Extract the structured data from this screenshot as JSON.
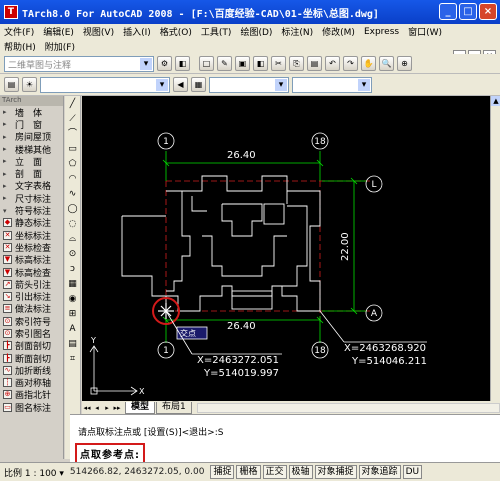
{
  "title": "TArch8.0 For AutoCAD 2008 - [F:\\百度经验-CAD\\01-坐标\\总图.dwg]",
  "window_buttons": {
    "minimize": "_",
    "maximize": "□",
    "close": "×"
  },
  "menu": {
    "row1": [
      "文件(F)",
      "编辑(E)",
      "视图(V)",
      "插入(I)",
      "格式(O)",
      "工具(T)",
      "绘图(D)",
      "标注(N)",
      "修改(M)",
      "Express",
      "窗口(W)"
    ],
    "row2": [
      "帮助(H)",
      "附加(F)"
    ]
  },
  "toolbar": {
    "workspace": "二维草图与注释",
    "layer_combo": "",
    "tool_icons": [
      "□",
      "✎",
      "▣",
      "◧",
      "✂",
      "⎘",
      "▤",
      "↶",
      "↷",
      "✋",
      "🔍",
      "⊕"
    ]
  },
  "left_panel": {
    "header": "TArch",
    "items": [
      {
        "label": "墙　体",
        "arrow": "▸"
      },
      {
        "label": "门　窗",
        "arrow": "▸"
      },
      {
        "label": "房间屋顶",
        "arrow": "▸"
      },
      {
        "label": "楼梯其他",
        "arrow": "▸"
      },
      {
        "label": "立　面",
        "arrow": "▸"
      },
      {
        "label": "剖　面",
        "arrow": "▸"
      },
      {
        "label": "文字表格",
        "arrow": "▸"
      },
      {
        "label": "尺寸标注",
        "arrow": "▸"
      },
      {
        "label": "符号标注",
        "arrow": "▾"
      },
      {
        "label": "静态标注",
        "icon": "◆"
      },
      {
        "label": "坐标标注",
        "icon": "✕"
      },
      {
        "label": "坐标检查",
        "icon": "✕"
      },
      {
        "label": "标高标注",
        "icon": "▼"
      },
      {
        "label": "标高检查",
        "icon": "▼"
      },
      {
        "label": "箭头引注",
        "icon": "↗"
      },
      {
        "label": "引出标注",
        "icon": "↘"
      },
      {
        "label": "做法标注",
        "icon": "≡"
      },
      {
        "label": "索引符号",
        "icon": "⊙"
      },
      {
        "label": "索引图名",
        "icon": "⊙"
      },
      {
        "label": "剖面剖切",
        "icon": "┣"
      },
      {
        "label": "断面剖切",
        "icon": "┣"
      },
      {
        "label": "加折断线",
        "icon": "∿"
      },
      {
        "label": "画对称轴",
        "icon": "┆"
      },
      {
        "label": "画指北针",
        "icon": "⊕"
      },
      {
        "label": "图名标注",
        "icon": "▭"
      }
    ]
  },
  "draw_tools": [
    "╱",
    "⟋",
    "⌒",
    "▭",
    "⬠",
    "◠",
    "∿",
    "◯",
    "◌",
    "⌓",
    "⊙",
    "ɔ",
    "▦",
    "◉",
    "⊞",
    "A",
    "▤",
    "⌗"
  ],
  "drawing": {
    "dim_top": "26.40",
    "dim_bottom": "26.40",
    "dim_right": "22.00",
    "axis_1_top": "1",
    "axis_18_top": "18",
    "axis_1_bottom": "1",
    "axis_18_bottom": "18",
    "axis_L": "L",
    "axis_A": "A",
    "snap_label": "交点",
    "coord_left_x": "X=2463272.051",
    "coord_left_y": "Y=514019.997",
    "coord_right_x": "X=2463268.920",
    "coord_right_y": "Y=514046.211",
    "ucs_x": "X",
    "ucs_y": "Y"
  },
  "tabs": {
    "nav": [
      "◂◂",
      "◂",
      "▸",
      "▸▸"
    ],
    "items": [
      "模型",
      "布局1"
    ],
    "active": "模型"
  },
  "command": {
    "line1": "请点取标注点或 [设置(S)]<退出>:S",
    "line2": "点取参考点:"
  },
  "status": {
    "scale": "比例 1 : 100 ▾",
    "coords": "514266.82, 2463272.05, 0.00",
    "buttons": [
      "捕捉",
      "栅格",
      "正交",
      "极轴",
      "对象捕捉",
      "对象追踪",
      "DU"
    ]
  },
  "colors": {
    "title_bar": "#0a3fc8",
    "canvas": "#000000",
    "drawing_lines": "#ffffff",
    "dim_lines": "#00ff00",
    "ref_lines": "#d02020",
    "highlight": "#d31a1a"
  }
}
